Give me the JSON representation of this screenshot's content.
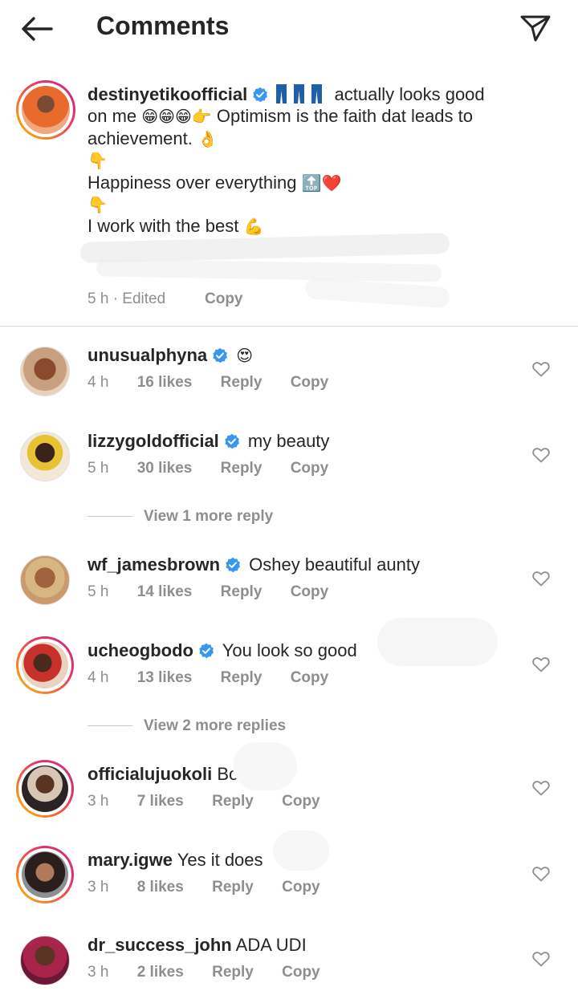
{
  "header": {
    "title": "Comments",
    "back_icon": "arrow-left-icon",
    "share_icon": "paper-plane-icon"
  },
  "caption": {
    "username": "destinyetikoofficial",
    "line1_text": "actually looks good",
    "line2_prefix": "on me",
    "line2_emojis": "😁😁😁👉",
    "line2_text": "Optimism is the faith dat leads to",
    "line3_text": "achievement.",
    "line3_emoji": "👌",
    "pointer_emoji": "👇",
    "line4_text": "Happiness over everything",
    "line4_emojis": "🔝❤️",
    "line6_text": "I work with the best",
    "line6_emoji": "💪",
    "time": "5 h",
    "edited": "· Edited",
    "copy": "Copy"
  },
  "comments": [
    {
      "username": "unusualphyna",
      "verified": true,
      "text": "😍",
      "time": "4 h",
      "likes": "16 likes",
      "reply": "Reply",
      "copy": "Copy"
    },
    {
      "username": "lizzygoldofficial",
      "verified": true,
      "text": "my beauty",
      "time": "5 h",
      "likes": "30 likes",
      "reply": "Reply",
      "copy": "Copy"
    },
    {
      "username": "wf_jamesbrown",
      "verified": true,
      "text": "Oshey beautiful aunty",
      "time": "5 h",
      "likes": "14 likes",
      "reply": "Reply",
      "copy": "Copy"
    },
    {
      "username": "ucheogbodo",
      "verified": true,
      "text": "You look so good",
      "time": "4 h",
      "likes": "13 likes",
      "reply": "Reply",
      "copy": "Copy"
    },
    {
      "username": "officialujuokoli",
      "verified": false,
      "text": "Boo",
      "time": "3 h",
      "likes": "7 likes",
      "reply": "Reply",
      "copy": "Copy"
    },
    {
      "username": "mary.igwe",
      "verified": false,
      "text": "Yes it does",
      "time": "3 h",
      "likes": "8 likes",
      "reply": "Reply",
      "copy": "Copy"
    },
    {
      "username": "dr_success_john",
      "verified": false,
      "text": "ADA UDI",
      "time": "3 h",
      "likes": "2 likes",
      "reply": "Reply",
      "copy": "Copy"
    }
  ],
  "view_more": {
    "after_lizzy": "View 1 more reply",
    "after_uche": "View 2 more replies"
  },
  "colors": {
    "verified": "#3897f0",
    "text": "#262626",
    "muted": "#8e8e8e",
    "story_ring_start": "#f9c100",
    "story_ring_end": "#c13584"
  }
}
